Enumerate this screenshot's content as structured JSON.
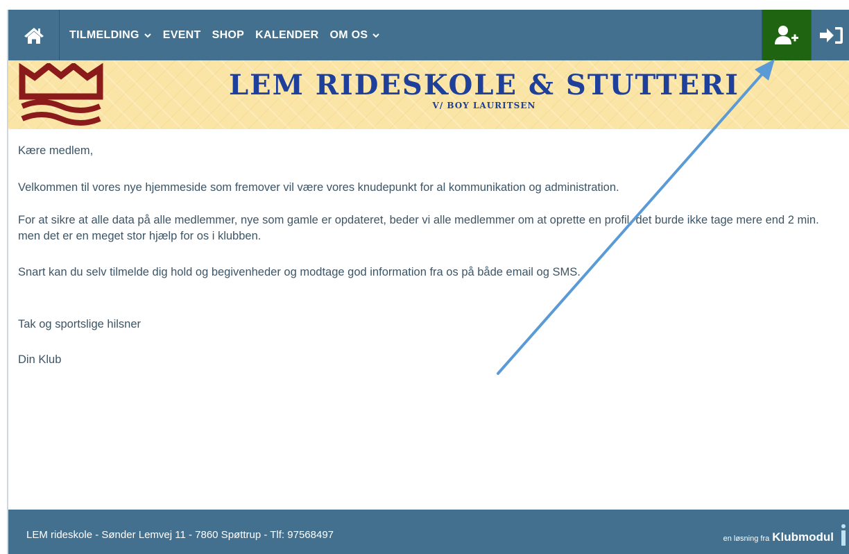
{
  "nav": {
    "items": [
      {
        "label": "TILMELDING",
        "dropdown": true
      },
      {
        "label": "EVENT",
        "dropdown": false
      },
      {
        "label": "SHOP",
        "dropdown": false
      },
      {
        "label": "KALENDER",
        "dropdown": false
      },
      {
        "label": "OM OS",
        "dropdown": true
      }
    ],
    "icons": {
      "home": "home-icon",
      "signup": "user-plus-icon",
      "login": "sign-in-icon"
    }
  },
  "banner": {
    "title": "LEM RIDESKOLE & STUTTERI",
    "subtitle": "V/ BOY LAURITSEN"
  },
  "content": {
    "greeting": "Kære medlem,",
    "welcome": "Velkommen til vores nye hjemmeside som fremover vil være vores knudepunkt for al kommunikation og administration.",
    "profile_request": "For at sikre at alle data på alle medlemmer, nye som gamle er opdateret, beder vi alle medlemmer om at oprette en profil, det burde ikke tage mere end 2 min. men det er en meget stor hjælp for os i klubben.",
    "signup_info": "Snart kan du selv tilmelde dig hold og begivenheder og modtage god information fra os på både email og SMS.",
    "closing": "Tak og sportslige hilsner",
    "signature": "Din Klub"
  },
  "footer": {
    "address": "LEM rideskole - Sønder Lemvej 11 - 7860 Spøttrup - Tlf: 97568497",
    "credit_prefix": "en løsning fra",
    "credit_brand": "Klubmodul"
  },
  "colors": {
    "nav_bg": "#43708f",
    "signup_bg": "#1f6410",
    "banner_bg": "#fbe5a6",
    "banner_text": "#1e3f9a",
    "logo": "#8b1a1a",
    "body_text": "#3c5566",
    "arrow": "#5b9bd5"
  }
}
